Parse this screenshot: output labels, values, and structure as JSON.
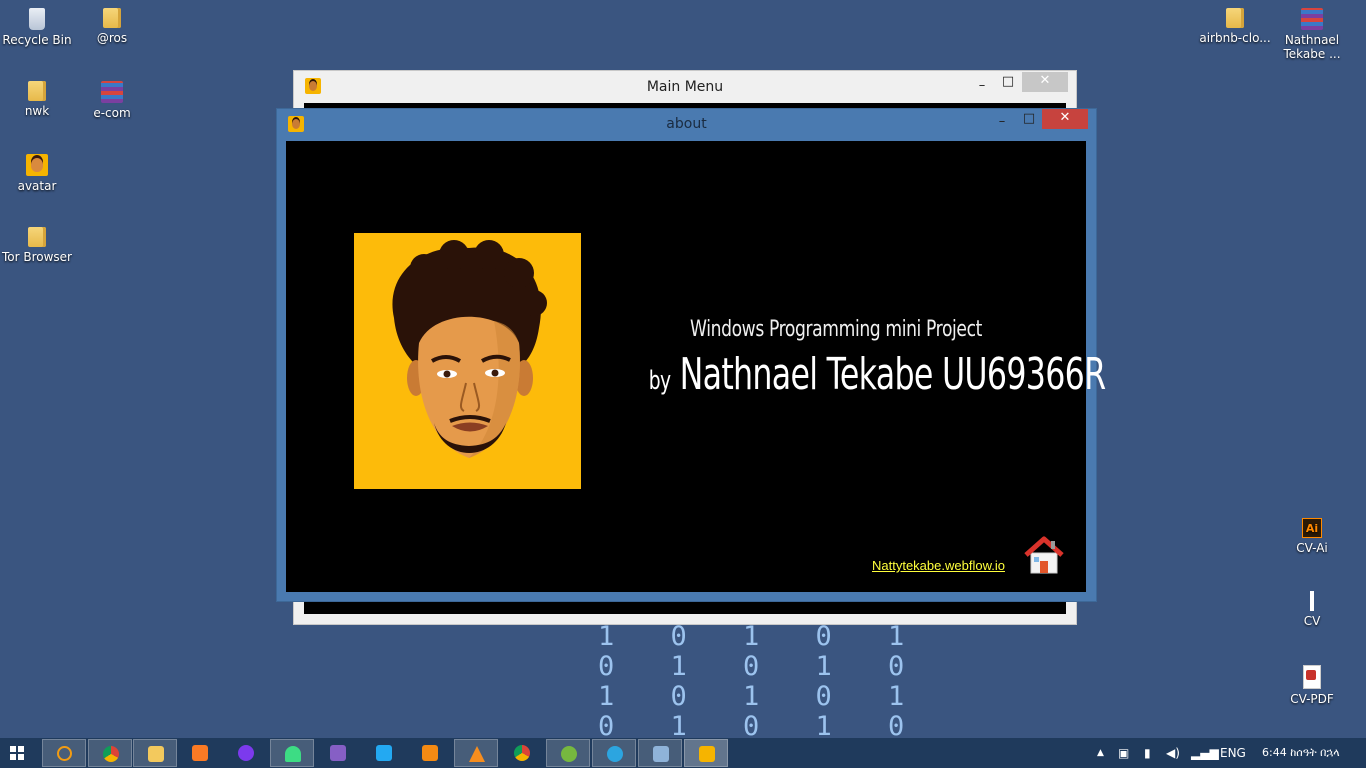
{
  "desktop": {
    "icons_left": [
      {
        "label": "Recycle Bin",
        "icon": "recycle-bin-icon"
      },
      {
        "label": "@ros",
        "icon": "folder-icon"
      },
      {
        "label": "nwk",
        "icon": "folder-icon"
      },
      {
        "label": "e-com",
        "icon": "winrar-archive-icon"
      },
      {
        "label": "avatar",
        "icon": "avatar-image-icon"
      },
      {
        "label": "Tor Browser",
        "icon": "folder-icon"
      }
    ],
    "icons_right": [
      {
        "label": "airbnb-clo...",
        "icon": "folder-icon"
      },
      {
        "label": "Nathnael Tekabe ...",
        "icon": "winrar-archive-icon"
      },
      {
        "label": "CV-Ai",
        "icon": "illustrator-file-icon"
      },
      {
        "label": "CV",
        "icon": "document-icon"
      },
      {
        "label": "CV-PDF",
        "icon": "pdf-file-icon"
      }
    ],
    "background_binary": [
      "1 0 1 0 1",
      "0 1 0 1 0",
      "1 0 1 0 1",
      "0 1 0 1 0"
    ]
  },
  "main_window": {
    "title": "Main Menu",
    "minimize": "–",
    "maximize": "□",
    "close": "✕"
  },
  "about_window": {
    "title": "about",
    "minimize": "–",
    "maximize": "□",
    "close": "✕",
    "heading": "Windows Programming mini Project",
    "by": "by",
    "author": "Nathnael Tekabe UU69366R",
    "link": "Nattytekabe.webflow.io"
  },
  "taskbar": {
    "apps": [
      "search-icon",
      "chrome-icon",
      "file-explorer-icon",
      "xampp-icon",
      "github-desktop-icon",
      "android-studio-icon",
      "visual-studio-icon",
      "vscode-icon",
      "sublime-text-icon",
      "vlc-icon",
      "chrome-icon",
      "utorrent-icon",
      "telegram-icon",
      "remote-desktop-icon",
      "avatar-app-icon"
    ],
    "language": "ENG",
    "clock": "6:44 ከሰዓት በኋላ"
  },
  "colors": {
    "desktop": "#3a5580",
    "taskbar": "#1f3a5c",
    "about_frame": "#4a7ab0",
    "portrait_bg": "#fdbb0a",
    "link": "#ffff3c"
  }
}
